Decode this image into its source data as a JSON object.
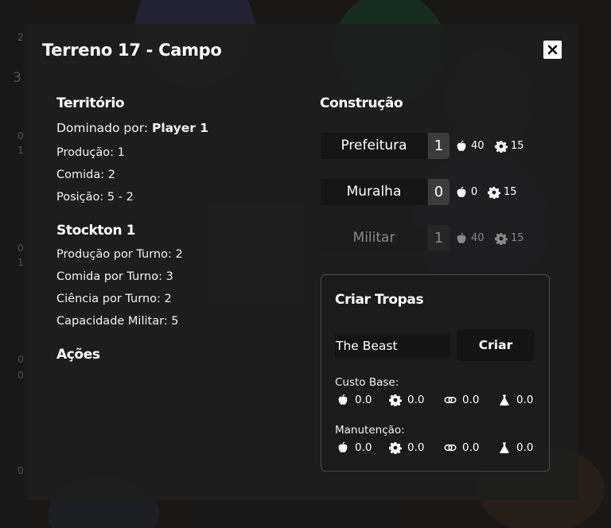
{
  "background": {
    "cells": [
      {
        "value": "2"
      },
      {
        "value": "3"
      },
      {
        "value": "0"
      },
      {
        "value": "1"
      },
      {
        "value": "0"
      },
      {
        "value": "1"
      },
      {
        "value": "0"
      },
      {
        "value": "0"
      },
      {
        "value": "0"
      }
    ]
  },
  "modal": {
    "title": "Terreno 17 - Campo",
    "close_label": "close"
  },
  "territory": {
    "heading": "Território",
    "dominated_label": "Dominado por:",
    "dominated_value": "Player 1",
    "production": "Produção: 1",
    "food": "Comida: 2",
    "position": "Posição: 5 - 2"
  },
  "city": {
    "heading": "Stockton 1",
    "production_per_turn": "Produção por Turno: 2",
    "food_per_turn": "Comida por Turno: 3",
    "science_per_turn": "Ciência por Turno: 2",
    "military_capacity": "Capacidade Militar: 5"
  },
  "actions": {
    "heading": "Ações"
  },
  "construction": {
    "heading": "Construção",
    "buildings": [
      {
        "name": "Prefeitura",
        "level": "1",
        "food_cost": "40",
        "production_cost": "15",
        "enabled": true
      },
      {
        "name": "Muralha",
        "level": "0",
        "food_cost": "0",
        "production_cost": "15",
        "enabled": true
      },
      {
        "name": "Militar",
        "level": "1",
        "food_cost": "40",
        "production_cost": "15",
        "enabled": false
      }
    ]
  },
  "troops": {
    "heading": "Criar Tropas",
    "selected_troop": "The Beast",
    "create_label": "Criar",
    "base_cost_label": "Custo Base:",
    "base_cost": {
      "food": "0.0",
      "production": "0.0",
      "gold": "0.0",
      "science": "0.0"
    },
    "upkeep_label": "Manutenção:",
    "upkeep": {
      "food": "0.0",
      "production": "0.0",
      "gold": "0.0",
      "science": "0.0"
    }
  },
  "icons": {
    "food": "apple-icon",
    "production": "gear-icon",
    "gold": "coins-icon",
    "science": "flask-icon"
  },
  "colors": {
    "modal_bg": "#1e1e1e",
    "button_bg": "#141414",
    "level_badge": "#3c3c3c"
  }
}
